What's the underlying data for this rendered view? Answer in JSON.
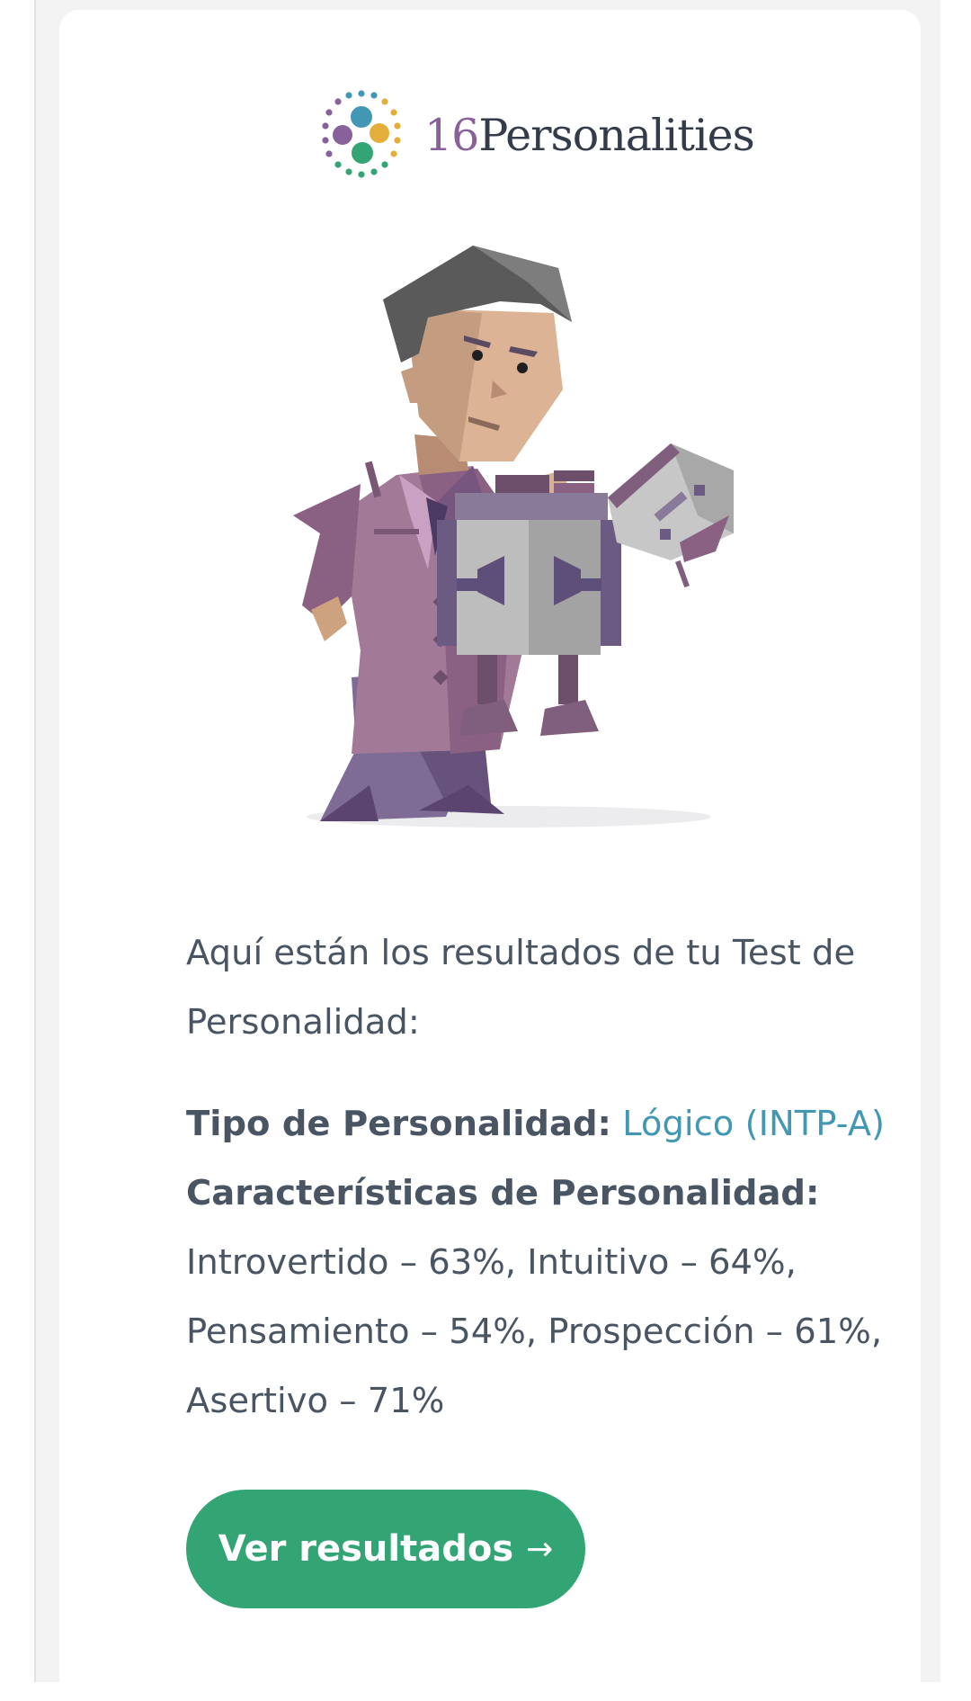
{
  "brand": {
    "logo_number": "16",
    "logo_word": "Personalities"
  },
  "content": {
    "intro": "Aquí están los resultados de tu Test de Personalidad:",
    "type_label": "Tipo de Personalidad:",
    "type_value": "Lógico (INTP-A)",
    "traits_label": "Características de Personalidad:",
    "traits_text": "Introvertido – 63%, Intuitivo – 64%, Pensamiento – 54%, Prospección – 61%, Asertivo – 71%"
  },
  "cta": {
    "label": "Ver resultados",
    "arrow": "→"
  },
  "colors": {
    "accent_green": "#33a474",
    "link_blue": "#4298b4",
    "logo_purple": "#88619a",
    "text": "#4a5563"
  },
  "icons": {
    "logo_mark": "dots-cluster-icon",
    "arrow": "arrow-right-icon"
  }
}
